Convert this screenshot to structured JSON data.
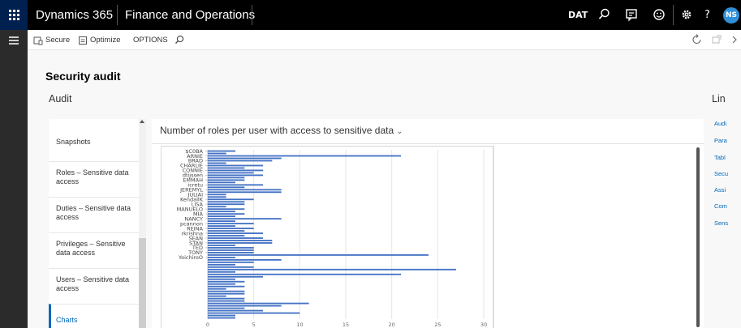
{
  "topbar": {
    "app_name": "Dynamics 365",
    "module_name": "Finance and Operations",
    "company": "DAT",
    "user_initials": "NS",
    "help_label": "?"
  },
  "actionbar": {
    "secure_label": "Secure",
    "optimize_label": "Optimize",
    "options_label": "OPTIONS"
  },
  "page": {
    "title": "Security audit",
    "section": "Audit"
  },
  "tiles": [
    {
      "label": "Snapshots"
    },
    {
      "label": "Roles – Sensitive data access"
    },
    {
      "label": "Duties – Sensitive data access"
    },
    {
      "label": "Privileges – Sensitive data access"
    },
    {
      "label": "Users – Sensitive data access"
    },
    {
      "label": "Charts"
    }
  ],
  "right_panel": {
    "title": "Lin",
    "links": [
      "Audi",
      "Para",
      "Tabl",
      "Secu",
      "Assi",
      "Com",
      "Sens"
    ]
  },
  "colors": {
    "accent": "#0067b8",
    "bar": "#4472c4",
    "nav_bg": "#000000",
    "waffle_bg": "#002050"
  },
  "icons": [
    "waffle-icon",
    "search-icon",
    "chat-icon",
    "smiley-icon",
    "gear-icon",
    "hamburger-icon",
    "shield-icon",
    "optimize-icon",
    "refresh-icon",
    "popout-icon",
    "close-icon"
  ],
  "chart_data": {
    "type": "bar",
    "orientation": "horizontal",
    "title": "Number of roles per user with access to sensitive data",
    "xlabel": "",
    "ylabel": "",
    "xlim": [
      0,
      30
    ],
    "xticks": [
      0,
      5,
      10,
      15,
      20,
      25,
      30
    ],
    "grid": true,
    "categories": [
      "$C0BA",
      "",
      "ARNIE",
      "",
      "BRAD",
      "",
      "CHARLIE",
      "",
      "CONNIE",
      "",
      "dtijssen",
      "",
      "EMMAH",
      "",
      "icretu",
      "",
      "JEREMYL",
      "",
      "JULIAI",
      "",
      "KendallK",
      "",
      "LISA",
      "",
      "MANUELO",
      "",
      "MIA",
      "",
      "NANCY",
      "",
      "pcannon",
      "",
      "REINA",
      "",
      "rkrishna",
      "",
      "SEAN",
      "",
      "STAN",
      "",
      "TED",
      "",
      "TONY",
      "",
      "YoichiroO",
      ""
    ],
    "values": [
      3,
      2,
      21,
      8,
      7,
      2,
      6,
      4,
      6,
      5,
      6,
      4,
      4,
      3,
      6,
      4,
      8,
      8,
      2,
      2,
      5,
      4,
      4,
      2,
      4,
      3,
      4,
      3,
      8,
      3,
      5,
      3,
      5,
      4,
      6,
      4,
      6,
      7,
      7,
      3,
      5,
      5,
      5,
      24,
      3,
      8,
      5,
      3,
      5,
      27,
      3,
      21,
      6,
      3,
      4,
      3,
      4,
      2,
      4,
      4,
      2,
      4,
      4,
      11,
      8,
      4,
      6,
      10,
      3,
      3
    ]
  }
}
